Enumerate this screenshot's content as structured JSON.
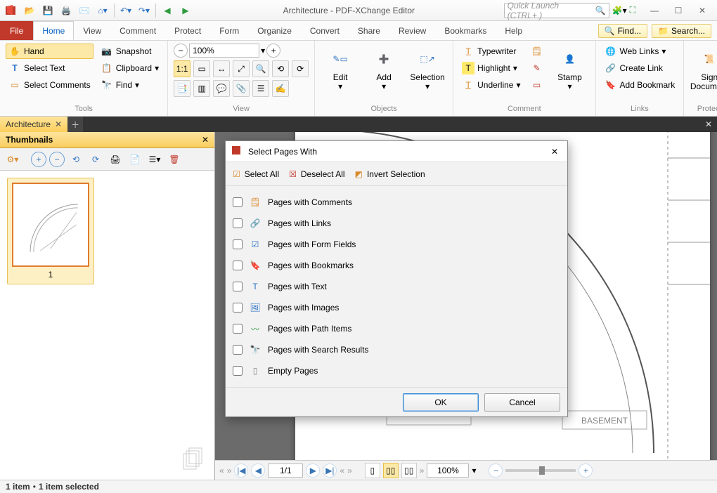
{
  "titlebar": {
    "title": "Architecture - PDF-XChange Editor",
    "quick_launch_placeholder": "Quick Launch (CTRL+.)"
  },
  "menubar": {
    "file": "File",
    "tabs": [
      "Home",
      "View",
      "Comment",
      "Protect",
      "Form",
      "Organize",
      "Convert",
      "Share",
      "Review",
      "Bookmarks",
      "Help"
    ],
    "active": "Home",
    "find": "Find...",
    "search": "Search..."
  },
  "ribbon": {
    "tools": {
      "hand": "Hand",
      "select_text": "Select Text",
      "select_comments": "Select Comments",
      "snapshot": "Snapshot",
      "clipboard": "Clipboard",
      "find": "Find",
      "label": "Tools"
    },
    "view": {
      "zoom_value": "100%",
      "label": "View"
    },
    "objects": {
      "edit": "Edit",
      "add": "Add",
      "selection": "Selection",
      "label": "Objects"
    },
    "comment": {
      "typewriter": "Typewriter",
      "highlight": "Highlight",
      "underline": "Underline",
      "stamp": "Stamp",
      "label": "Comment"
    },
    "links": {
      "web_links": "Web Links",
      "create_link": "Create Link",
      "add_bookmark": "Add Bookmark",
      "label": "Links"
    },
    "protect": {
      "sign": "Sign",
      "document": "Document",
      "label": "Protect"
    }
  },
  "doctab": {
    "name": "Architecture"
  },
  "thumbnails": {
    "title": "Thumbnails",
    "page_number": "1"
  },
  "viewbar": {
    "page_field": "1/1",
    "zoom": "100%"
  },
  "status": {
    "items": "1 item",
    "selected": "1 item selected"
  },
  "dialog": {
    "title": "Select Pages With",
    "select_all": "Select All",
    "deselect_all": "Deselect All",
    "invert": "Invert Selection",
    "rows": [
      "Pages with Comments",
      "Pages with Links",
      "Pages with Form Fields",
      "Pages with Bookmarks",
      "Pages with Text",
      "Pages with Images",
      "Pages with Path Items",
      "Pages with Search Results",
      "Empty Pages"
    ],
    "ok": "OK",
    "cancel": "Cancel"
  }
}
